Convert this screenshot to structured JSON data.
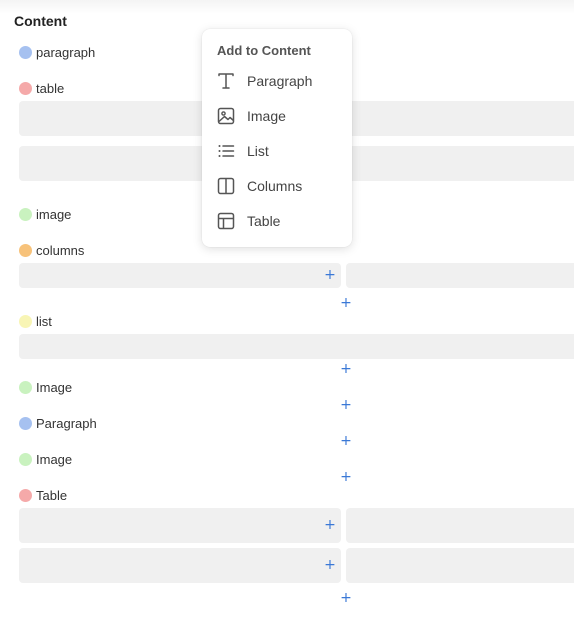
{
  "colors": {
    "blue": "#a6c1f0",
    "red": "#f5a9a9",
    "green": "#c9f2bf",
    "orange": "#f7c27a",
    "yellow": "#f8f5b5",
    "plus": "#3a78d6",
    "box": "#f0f0f0"
  },
  "section": {
    "title": "Content"
  },
  "items": [
    {
      "label": "paragraph",
      "dot": "blue"
    },
    {
      "label": "table",
      "dot": "red"
    },
    {
      "label": "image",
      "dot": "green"
    },
    {
      "label": "columns",
      "dot": "orange"
    },
    {
      "label": "list",
      "dot": "yellow"
    },
    {
      "label": "Image",
      "dot": "green"
    },
    {
      "label": "Paragraph",
      "dot": "blue"
    },
    {
      "label": "Image",
      "dot": "green"
    },
    {
      "label": "Table",
      "dot": "red"
    }
  ],
  "add_symbol": "+",
  "menu": {
    "title": "Add to Content",
    "items": [
      {
        "label": "Paragraph",
        "icon": "text-icon"
      },
      {
        "label": "Image",
        "icon": "image-icon"
      },
      {
        "label": "List",
        "icon": "list-icon"
      },
      {
        "label": "Columns",
        "icon": "columns-icon"
      },
      {
        "label": "Table",
        "icon": "table-icon"
      }
    ]
  }
}
